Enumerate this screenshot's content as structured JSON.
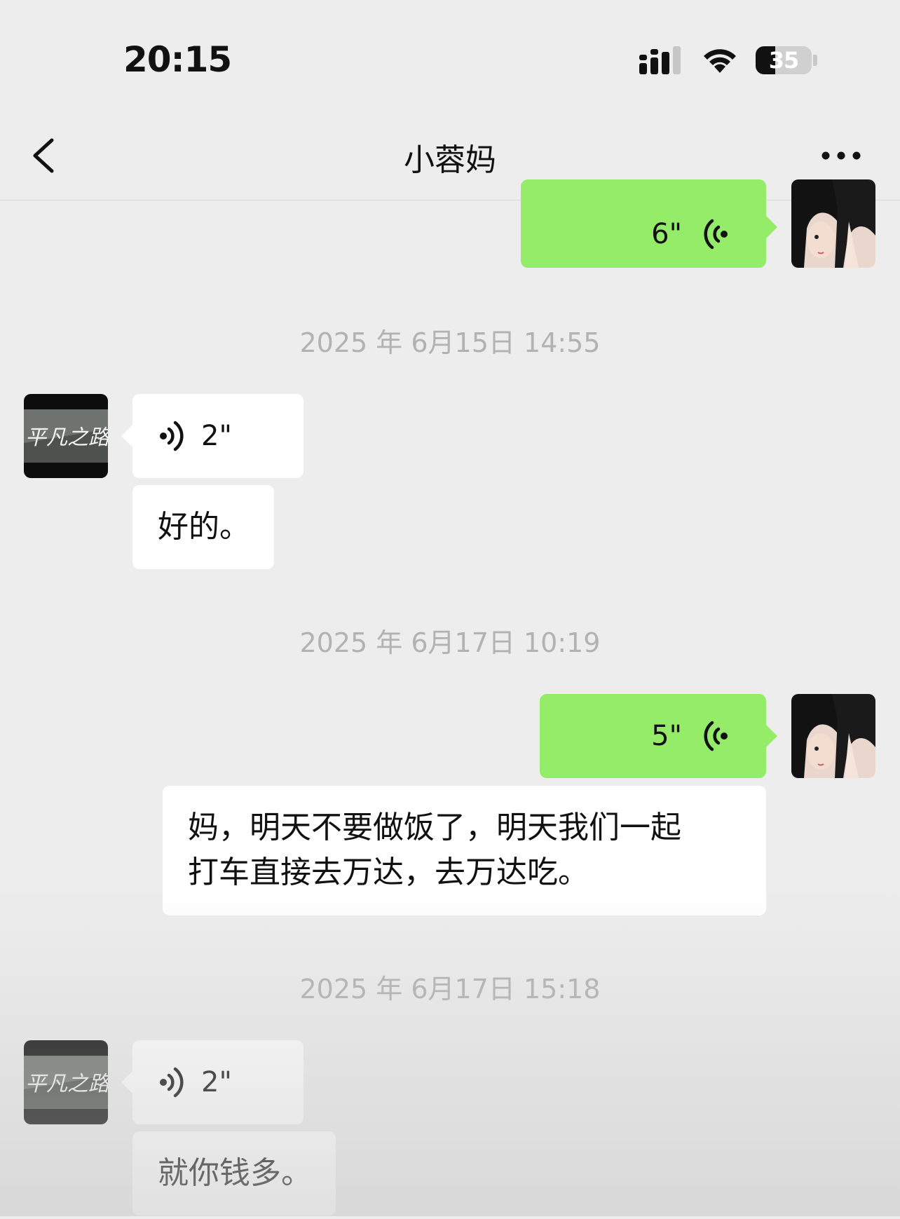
{
  "status_bar": {
    "time": "20:15",
    "battery": "35"
  },
  "header": {
    "title": "小蓉妈"
  },
  "messages": [
    {
      "type": "voice",
      "side": "right",
      "duration": "6\""
    },
    {
      "type": "timestamp",
      "text": "2025 年 6月15日 14:55"
    },
    {
      "type": "voice",
      "side": "left",
      "duration": "2\""
    },
    {
      "type": "text",
      "side": "left",
      "text": "好的。"
    },
    {
      "type": "timestamp",
      "text": "2025 年 6月17日 10:19"
    },
    {
      "type": "voice",
      "side": "right",
      "duration": "5\""
    },
    {
      "type": "text",
      "side": "right",
      "lines": [
        "妈，明天不要做饭了，明天我们一起",
        "打车直接去万达，去万达吃。"
      ]
    },
    {
      "type": "timestamp",
      "text": "2025 年 6月17日 15:18"
    },
    {
      "type": "voice",
      "side": "left",
      "duration": "2\""
    },
    {
      "type": "text",
      "side": "left",
      "text": "就你钱多。"
    }
  ],
  "contact_avatar_logo_text": "平凡之路",
  "colors": {
    "sent_bubble": "#95ec69",
    "received_bubble": "#ffffff",
    "background": "#ededed",
    "timestamp": "#b2b2b2"
  },
  "icons": [
    "back-icon",
    "more-icon",
    "signal-icon",
    "wifi-icon",
    "battery-icon",
    "voice-wave-icon"
  ]
}
